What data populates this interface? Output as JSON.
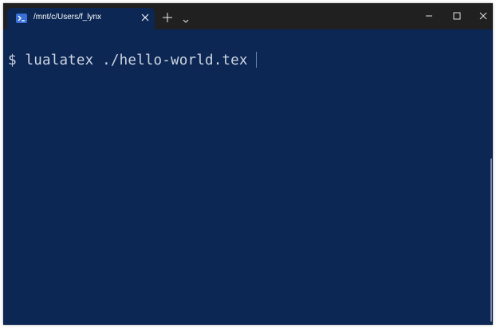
{
  "tab": {
    "title": "/mnt/c/Users/f_lynx",
    "icon": "powershell-icon"
  },
  "terminal": {
    "prompt": "$",
    "command": "lualatex ./hello-world.tex"
  },
  "colors": {
    "background": "#0c2754",
    "titlebar": "#202020",
    "text": "#cfd6e2",
    "tab_icon": "#3a6fd8"
  }
}
